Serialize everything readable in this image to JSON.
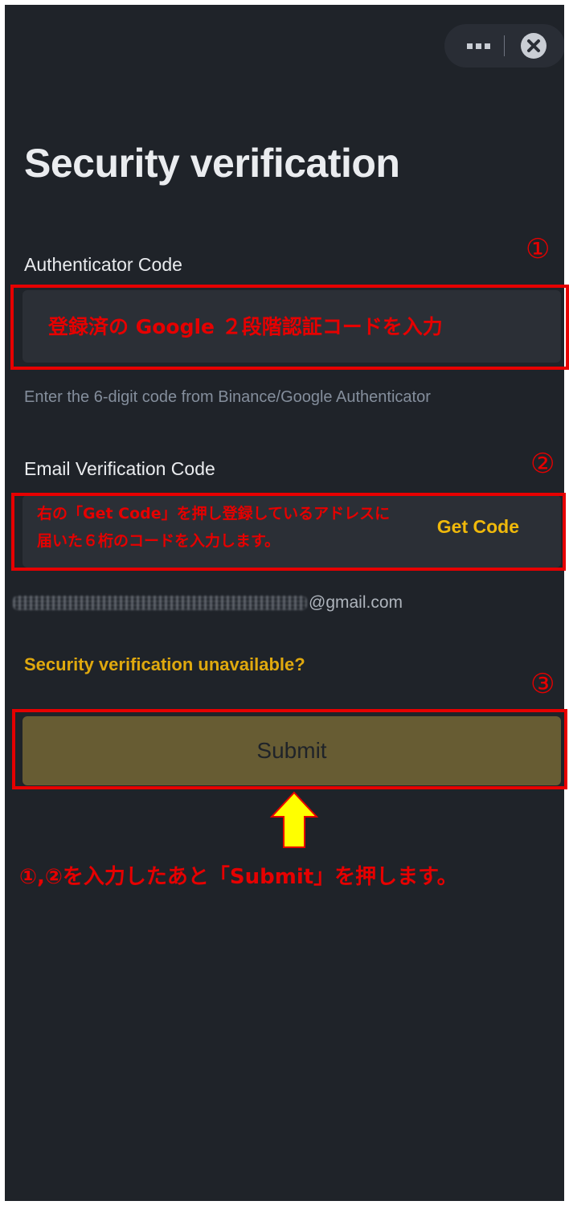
{
  "header": {
    "more_icon": "more-dots-icon",
    "close_icon": "close-circle-icon"
  },
  "page": {
    "title": "Security verification"
  },
  "authenticator": {
    "label": "Authenticator Code",
    "hint": "Enter the 6-digit code from Binance/Google Authenticator"
  },
  "email_verification": {
    "label": "Email Verification Code",
    "get_code_label": "Get Code",
    "email_suffix": "@gmail.com"
  },
  "links": {
    "unavailable": "Security verification unavailable?"
  },
  "submit": {
    "label": "Submit"
  },
  "annotations": {
    "marker_1": "①",
    "marker_2": "②",
    "marker_3": "③",
    "note_1": "登録済の Google ２段階認証コードを入力",
    "note_2_line1": "右の「Get Code」を押し登録しているアドレスに",
    "note_2_line2": "届いた６桁のコードを入力します。",
    "note_bottom": "①,②を入力したあと「Submit」を押します。",
    "color": "#e60000",
    "arrow_color": "#ffff00"
  },
  "colors": {
    "background": "#1f2329",
    "input_bg": "#2b2f36",
    "accent": "#f0b90b",
    "submit_bg": "#675c33"
  }
}
